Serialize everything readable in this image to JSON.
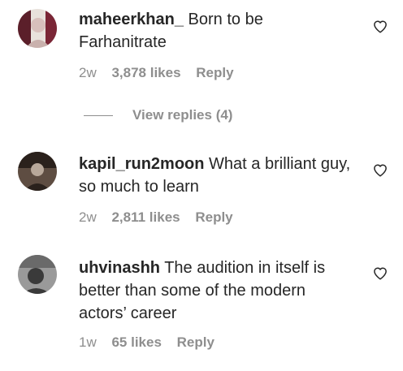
{
  "comments": [
    {
      "username": "maheerkhan_",
      "text": "Born to be Farhanitrate",
      "age": "2w",
      "likes": "3,878 likes",
      "reply_label": "Reply",
      "replies_label": "View replies (4)",
      "avatar_colors": [
        "#5b1f2a",
        "#d8c0bc",
        "#e8e2dc"
      ]
    },
    {
      "username": "kapil_run2moon",
      "text": "What a brilliant guy, so much to learn",
      "age": "2w",
      "likes": "2,811 likes",
      "reply_label": "Reply",
      "avatar_colors": [
        "#2a211c",
        "#5e4d42",
        "#b8a89a"
      ]
    },
    {
      "username": "uhvinashh",
      "text": "The audition in itself is better than some of the modern actors’ career",
      "age": "1w",
      "likes": "65 likes",
      "reply_label": "Reply",
      "avatar_colors": [
        "#3a3a3a",
        "#6a6a6a",
        "#9a9a9a"
      ]
    }
  ],
  "icons": {
    "heart": "heart-outline-icon"
  }
}
